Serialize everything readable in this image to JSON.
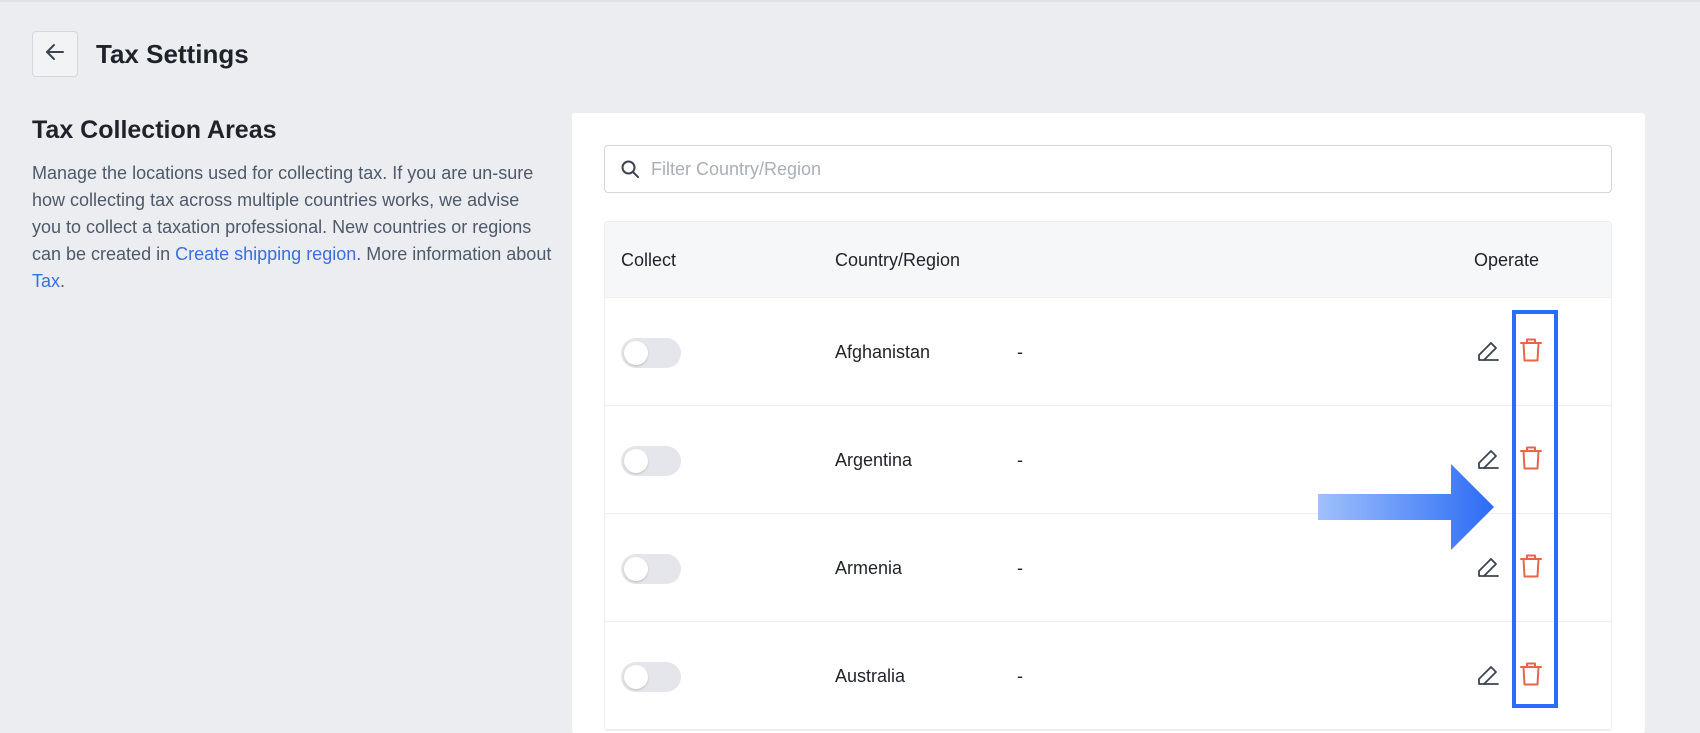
{
  "header": {
    "title": "Tax Settings",
    "back_icon": "arrow-left-icon"
  },
  "section": {
    "title": "Tax Collection Areas",
    "desc_part1": "Manage the locations used for collecting tax. If you are un-sure how collecting tax across multiple countries works, we advise you to collect a taxation professional. New countries or regions can be created in ",
    "link_shipping": "Create shipping region",
    "desc_part2": ". More information about ",
    "link_tax": "Tax",
    "desc_part3": "."
  },
  "search": {
    "placeholder": "Filter Country/Region",
    "value": "",
    "icon": "search-icon"
  },
  "table": {
    "columns": {
      "collect": "Collect",
      "country": "Country/Region",
      "operate": "Operate"
    },
    "rows": [
      {
        "collect": false,
        "country": "Afghanistan",
        "rate": "-"
      },
      {
        "collect": false,
        "country": "Argentina",
        "rate": "-"
      },
      {
        "collect": false,
        "country": "Armenia",
        "rate": "-"
      },
      {
        "collect": false,
        "country": "Australia",
        "rate": "-"
      }
    ]
  },
  "colors": {
    "accent_link": "#3a6fdc",
    "delete_icon": "#e5674a",
    "highlight": "#2b6cf6",
    "toggle_off": "#e5e6eb"
  },
  "icons": {
    "edit": "pencil-icon",
    "delete": "trash-icon"
  }
}
